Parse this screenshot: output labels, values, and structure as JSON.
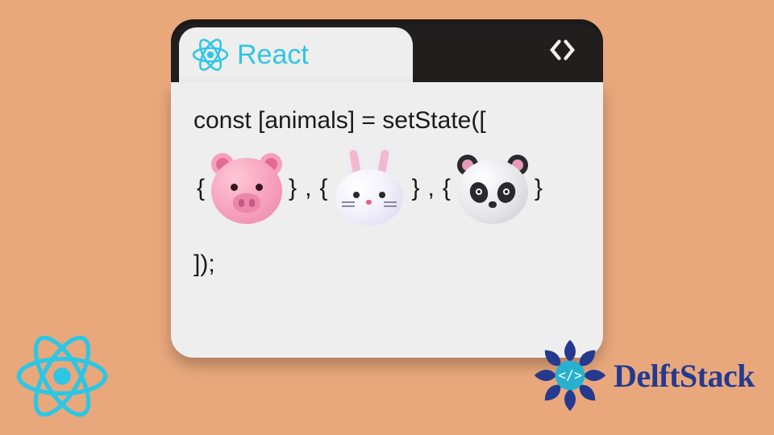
{
  "colors": {
    "background": "#e9a87c",
    "react_accent": "#2ec6e4",
    "delftstack_text": "#253a8e",
    "window_chrome": "#201f1e",
    "window_content": "#eeeeee"
  },
  "window": {
    "tab": {
      "title": "React",
      "icon": "react-atom-icon"
    },
    "nav": {
      "prev_icon": "chevron-left-icon",
      "next_icon": "chevron-right-icon"
    }
  },
  "code": {
    "line1": "const [animals] = setState([",
    "open_brace": "{",
    "close_brace": "}",
    "comma_space": ", ",
    "line3": "]);",
    "animals": [
      {
        "name": "pig-icon"
      },
      {
        "name": "bunny-icon"
      },
      {
        "name": "panda-icon"
      }
    ]
  },
  "footer": {
    "react_icon": "react-atom-icon",
    "delftstack_icon": "delftstack-mandala-icon",
    "delftstack_text": "DelftStack"
  }
}
